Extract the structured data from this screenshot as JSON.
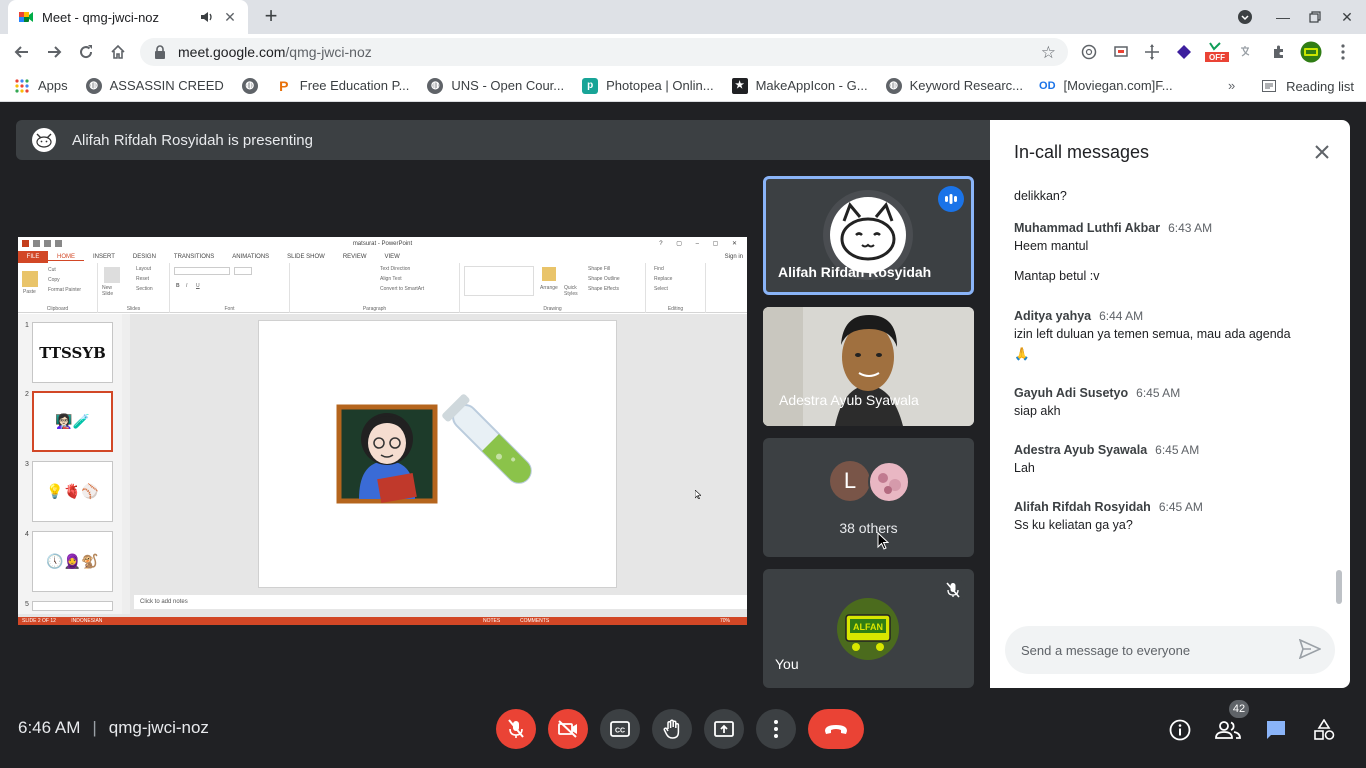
{
  "browser": {
    "tab_title": "Meet - qmg-jwci-noz",
    "url_host": "meet.google.com",
    "url_path": "/qmg-jwci-noz",
    "ext_off_label": "OFF",
    "bookmarks": [
      {
        "label": "Apps",
        "color": "#4285f4"
      },
      {
        "label": "ASSASSIN CREED",
        "color": "#5f6368"
      },
      {
        "label": "",
        "color": "#5f6368"
      },
      {
        "label": "Free Education P...",
        "color": "#e8710a"
      },
      {
        "label": "UNS - Open Cour...",
        "color": "#5f6368"
      },
      {
        "label": "Photopea | Onlin...",
        "color": "#18a497"
      },
      {
        "label": "MakeAppIcon - G...",
        "color": "#202124"
      },
      {
        "label": "Keyword Researc...",
        "color": "#5f6368"
      },
      {
        "label": "[Moviegan.com]F...",
        "color": "#1a73e8"
      }
    ],
    "bookmark_od": "OD",
    "reading_list": "Reading list"
  },
  "meet": {
    "presenting_text": "Alifah Rifdah Rosyidah is presenting",
    "ppt": {
      "window_title": "matsurat - PowerPoint",
      "sign_in": "Sign in",
      "tabs": [
        "FILE",
        "HOME",
        "INSERT",
        "DESIGN",
        "TRANSITIONS",
        "ANIMATIONS",
        "SLIDE SHOW",
        "REVIEW",
        "VIEW"
      ],
      "groups": [
        "Clipboard",
        "Slides",
        "Font",
        "Paragraph",
        "Drawing",
        "Editing"
      ],
      "ribbon": {
        "paste": "Paste",
        "cut": "Cut",
        "copy": "Copy",
        "format_painter": "Format Painter",
        "new_slide": "New Slide",
        "layout": "Layout",
        "reset": "Reset",
        "section": "Section",
        "text_direction": "Text Direction",
        "align_text": "Align Text",
        "convert_smartart": "Convert to SmartArt",
        "arrange": "Arrange",
        "quick_styles": "Quick Styles",
        "shape_fill": "Shape Fill",
        "shape_outline": "Shape Outline",
        "shape_effects": "Shape Effects",
        "find": "Find",
        "replace": "Replace",
        "select": "Select"
      },
      "thumbnails": [
        {
          "num": "1",
          "title": "TTSSYB",
          "emoji": ""
        },
        {
          "num": "2",
          "title": "",
          "emoji": "👩🏻‍🏫🧪"
        },
        {
          "num": "3",
          "title": "",
          "emoji": "💡🫀⚾"
        },
        {
          "num": "4",
          "title": "",
          "emoji": "🕔🧕🐒"
        },
        {
          "num": "5",
          "title": "",
          "emoji": ""
        }
      ],
      "notes_placeholder": "Click to add notes",
      "status_slide": "SLIDE 2 OF 12",
      "status_lang": "INDONESIAN",
      "status_notes": "NOTES",
      "status_comments": "COMMENTS",
      "zoom": "70%"
    },
    "tiles": [
      {
        "name": "Alifah Rifdah Rosyidah"
      },
      {
        "name": "Adestra Ayub Syawala"
      },
      {
        "name": "38 others",
        "avatar_letter": "L"
      },
      {
        "name": "You",
        "avatar_text": "ALFAN"
      }
    ],
    "chat": {
      "title": "In-call messages",
      "messages": [
        {
          "sender": "",
          "time": "",
          "lines": [
            "delikkan?"
          ]
        },
        {
          "sender": "Muhammad Luthfi Akbar",
          "time": "6:43 AM",
          "lines": [
            "Heem mantul",
            "Mantap betul :v"
          ]
        },
        {
          "sender": "Aditya yahya",
          "time": "6:44 AM",
          "lines": [
            "izin left duluan ya temen semua, mau ada agenda",
            "🙏"
          ]
        },
        {
          "sender": "Gayuh Adi Susetyo",
          "time": "6:45 AM",
          "lines": [
            "siap akh"
          ]
        },
        {
          "sender": "Adestra Ayub Syawala",
          "time": "6:45 AM",
          "lines": [
            "Lah"
          ]
        },
        {
          "sender": "Alifah Rifdah Rosyidah",
          "time": "6:45 AM",
          "lines": [
            "Ss ku keliatan ga ya?"
          ]
        }
      ],
      "input_placeholder": "Send a message to everyone"
    },
    "bottom": {
      "time": "6:46 AM",
      "meeting_code": "qmg-jwci-noz",
      "participants_count": "42"
    }
  }
}
